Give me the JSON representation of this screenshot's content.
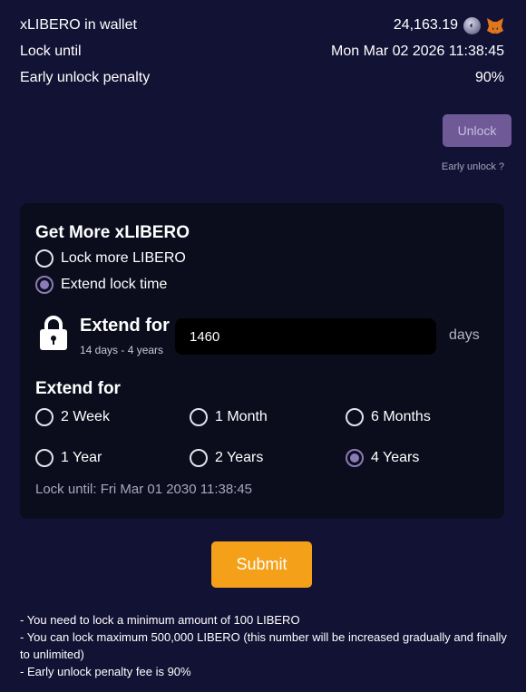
{
  "wallet": {
    "xlibero_label": "xLIBERO in wallet",
    "xlibero_value": "24,163.19",
    "lock_until_label": "Lock until",
    "lock_until_value": "Mon Mar 02 2026 11:38:45",
    "penalty_label": "Early unlock penalty",
    "penalty_value": "90%"
  },
  "unlock": {
    "button_label": "Unlock",
    "early_link": "Early unlock ?"
  },
  "card": {
    "title": "Get More xLIBERO",
    "mode_options": [
      {
        "label": "Lock more LIBERO",
        "checked": false
      },
      {
        "label": "Extend lock time",
        "checked": true
      }
    ],
    "extend_label": "Extend for",
    "extend_range": "14 days - 4 years",
    "days_value": "1460",
    "days_unit": "days",
    "duration_title": "Extend for",
    "durations": [
      {
        "label": "2 Week",
        "checked": false
      },
      {
        "label": "1 Month",
        "checked": false
      },
      {
        "label": "6 Months",
        "checked": false
      },
      {
        "label": "1 Year",
        "checked": false
      },
      {
        "label": "2 Years",
        "checked": false
      },
      {
        "label": "4 Years",
        "checked": true
      }
    ],
    "lock_until_text": "Lock until: Fri Mar 01 2030 11:38:45"
  },
  "submit_label": "Submit",
  "notes": [
    "- You need to lock a minimum amount of 100 LIBERO",
    "- You can lock maximum 500,000 LIBERO (this number will be increased gradually and finally to unlimited)",
    "- Early unlock penalty fee is 90%"
  ],
  "colors": {
    "background": "#121235",
    "card": "#0b0d1d",
    "accent": "#f5a019",
    "radio_checked": "#8b7bb6",
    "unlock_button": "#6f5a97"
  }
}
